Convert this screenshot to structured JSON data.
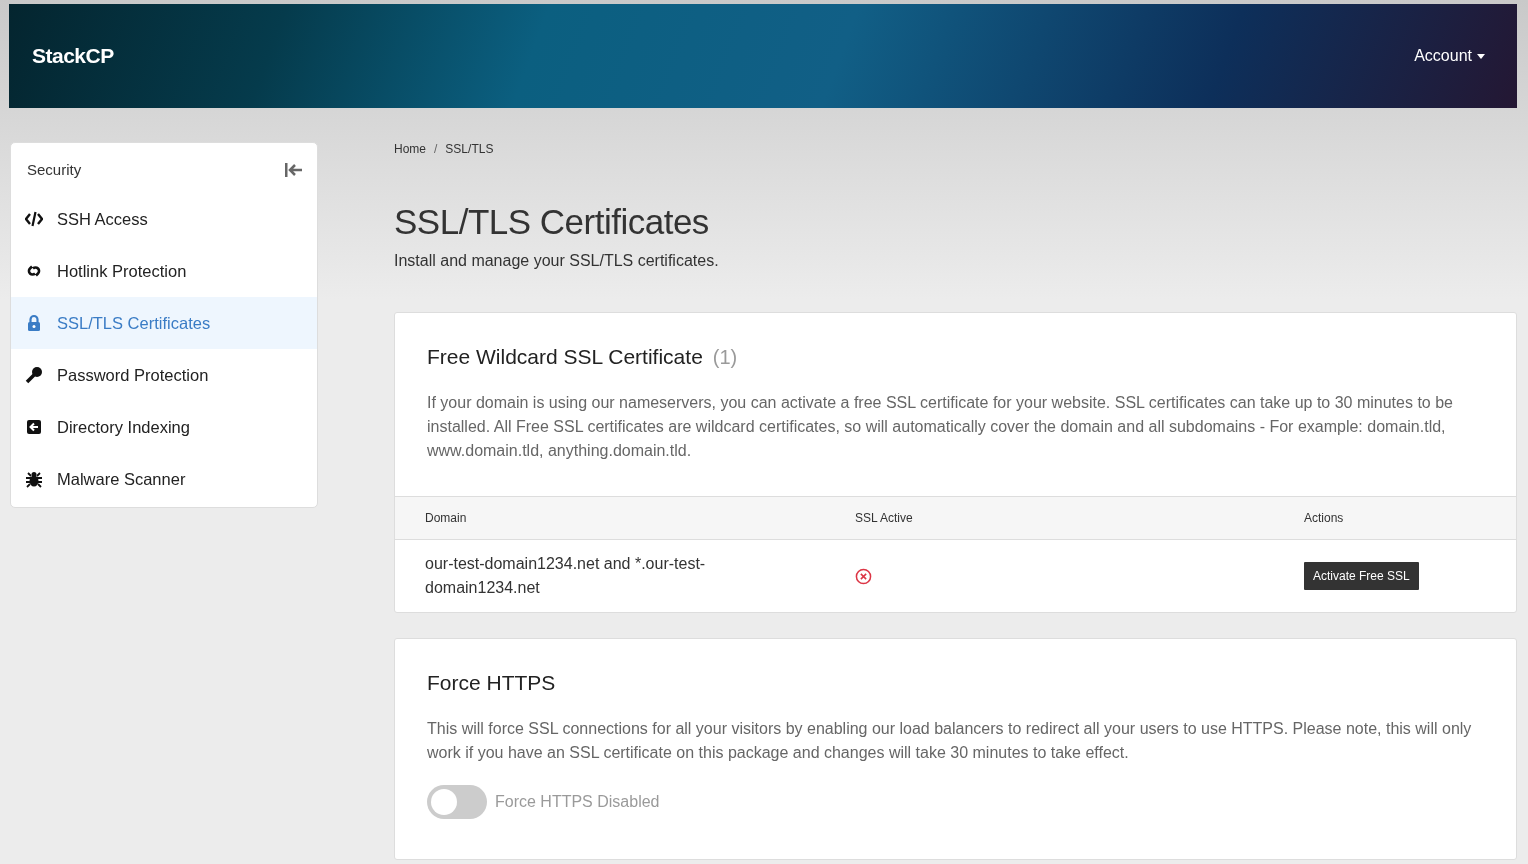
{
  "header": {
    "logo": "StackCP",
    "account_menu": "Account"
  },
  "sidebar": {
    "title": "Security",
    "items": [
      {
        "label": "SSH Access",
        "selected": false
      },
      {
        "label": "Hotlink Protection",
        "selected": false
      },
      {
        "label": "SSL/TLS Certificates",
        "selected": true
      },
      {
        "label": "Password Protection",
        "selected": false
      },
      {
        "label": "Directory Indexing",
        "selected": false
      },
      {
        "label": "Malware Scanner",
        "selected": false
      }
    ]
  },
  "breadcrumb": {
    "items": [
      "Home",
      "SSL/TLS"
    ],
    "separator": "/"
  },
  "page": {
    "title": "SSL/TLS Certificates",
    "subtitle": "Install and manage your SSL/TLS certificates."
  },
  "wildcard_card": {
    "title": "Free Wildcard SSL Certificate",
    "count": "(1)",
    "description": "If your domain is using our nameservers, you can activate a free SSL certificate for your website. SSL certificates can take up to 30 minutes to be installed. All Free SSL certificates are wildcard certificates, so will automatically cover the domain and all subdomains - For example: domain.tld, www.domain.tld, anything.domain.tld.",
    "table": {
      "columns": [
        "Domain",
        "SSL Active",
        "Actions"
      ],
      "rows": [
        {
          "domain": "our-test-domain1234.net and *.our-test-domain1234.net",
          "ssl_active": false,
          "action": "Activate Free SSL"
        }
      ]
    }
  },
  "https_card": {
    "title": "Force HTTPS",
    "description": "This will force SSL connections for all your visitors by enabling our load balancers to redirect all your users to use HTTPS. Please note, this will only work if you have an SSL certificate on this package and changes will take 30 minutes to take effect.",
    "toggle": {
      "on": false,
      "label": "Force HTTPS Disabled"
    }
  }
}
